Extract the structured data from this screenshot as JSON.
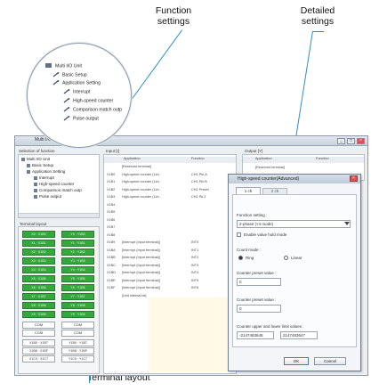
{
  "callouts": {
    "function_settings": "Function\nsettings",
    "detailed_settings": "Detailed\nsettings",
    "terminal_layout": "Terminal layout"
  },
  "window": {
    "title": "Multi I/O Unit",
    "left_pane_title": "Selection of function",
    "input_pane_title": "Input [I]",
    "output_pane_title": "Output [Y]",
    "terminal_title": "Terminal layout"
  },
  "tree": {
    "root": "Multi I/O Unit",
    "items": [
      "Basic Setup",
      "Application Setting",
      "Interrupt",
      "High-speed counter",
      "Comparison match outp",
      "Pulse output"
    ]
  },
  "magnifier_tree": {
    "root": "Multi I/O Unit",
    "items": [
      "Basic Setup",
      "Application Setting",
      "Interrupt",
      "High-speed counter",
      "Comparison match outp",
      "Pulse output"
    ]
  },
  "grid": {
    "headers": [
      "Application",
      "Function"
    ],
    "rows": [
      {
        "addr": "",
        "app": "[Reserved terminal]",
        "fn": ""
      },
      {
        "addr": "X1B0",
        "app": "High-speed counter (1ch..",
        "fn": "CH1 Phi.A"
      },
      {
        "addr": "X1B1",
        "app": "High-speed counter (1ch..",
        "fn": "CH1 Phi.B"
      },
      {
        "addr": "X1B2",
        "app": "High-speed counter (1ch..",
        "fn": "CH1 Preset"
      },
      {
        "addr": "X1B3",
        "app": "High-speed counter (1ch..",
        "fn": "CH1 PA Z"
      },
      {
        "addr": "X1B4",
        "app": "",
        "fn": ""
      },
      {
        "addr": "X1B5",
        "app": "",
        "fn": ""
      },
      {
        "addr": "X1B6",
        "app": "",
        "fn": ""
      },
      {
        "addr": "X1B7",
        "app": "",
        "fn": ""
      },
      {
        "addr": "X1B8",
        "app": "",
        "fn": ""
      },
      {
        "addr": "X1B9",
        "app": "[Interrupt (Input terminal)]",
        "fn": "INT0"
      },
      {
        "addr": "X1BA",
        "app": "[Interrupt (Input terminal)]",
        "fn": "INT1"
      },
      {
        "addr": "X1BB",
        "app": "[Interrupt (Input terminal)]",
        "fn": "INT2"
      },
      {
        "addr": "X1BC",
        "app": "[Interrupt (Input terminal)]",
        "fn": "INT3"
      },
      {
        "addr": "X1BD",
        "app": "[Interrupt (Input terminal)]",
        "fn": "INT4"
      },
      {
        "addr": "X1BE",
        "app": "[Interrupt (Input terminal)]",
        "fn": "INT5"
      },
      {
        "addr": "X1BF",
        "app": "[Interrupt (Input terminal)]",
        "fn": "INT6"
      },
      {
        "addr": "",
        "app": "[Unit internal bit]",
        "fn": ""
      }
    ]
  },
  "terminals": {
    "left": [
      "X0 · X1B0",
      "X1 · X1B1",
      "X2 · X1B2",
      "X3 · X1B3",
      "X4 · X1B4",
      "X5 · X1B5",
      "X6 · X1B6",
      "X7 · X1B7",
      "X8 · X1B8",
      "X9 · X1B9"
    ],
    "right": [
      "Y0 · Y1B0",
      "Y1 · Y1B1",
      "Y2 · Y1B2",
      "Y3 · Y1B3",
      "Y4 · Y1B4",
      "Y5 · Y1B5",
      "Y6 · Y1B6",
      "Y7 · Y1B7",
      "Y8 · Y1B8",
      "Y9 · Y1B9"
    ],
    "com_left": "COM",
    "com_right": "COM",
    "bottom_left": [
      "X1B0 · X1B7",
      "X1B8 · X1BF",
      "X1C0 · X1C7"
    ],
    "bottom_right": [
      "Y1B0 · Y1B7",
      "Y1B8 · Y1BF",
      "Y1C0 · Y1C7"
    ]
  },
  "dialog": {
    "title": "High-speed counter(Advanced)",
    "tab_label": "1 ch",
    "tab2_label": "2 ch",
    "function_setting_label": "Function setting :",
    "function_setting_value": "2-phase (×4 mode)",
    "checkbox_label": "Enable value hold mode",
    "count_mode_label": "Count mode :",
    "radio1": "Ring",
    "radio2": "Linear",
    "counter_preset_label": "Counter preset value :",
    "counter_preset_value": "0",
    "counter_preset2_label": "Counter preset value :",
    "counter_preset2_value": "0",
    "limit_label": "Counter upper and lower limit values :",
    "limit_low": "-2147483648",
    "limit_high": "2147483647",
    "ok": "OK",
    "cancel": "Cancel"
  },
  "colors": {
    "callout_line": "#2d8fc5",
    "terminal_green": "#34a83b"
  }
}
